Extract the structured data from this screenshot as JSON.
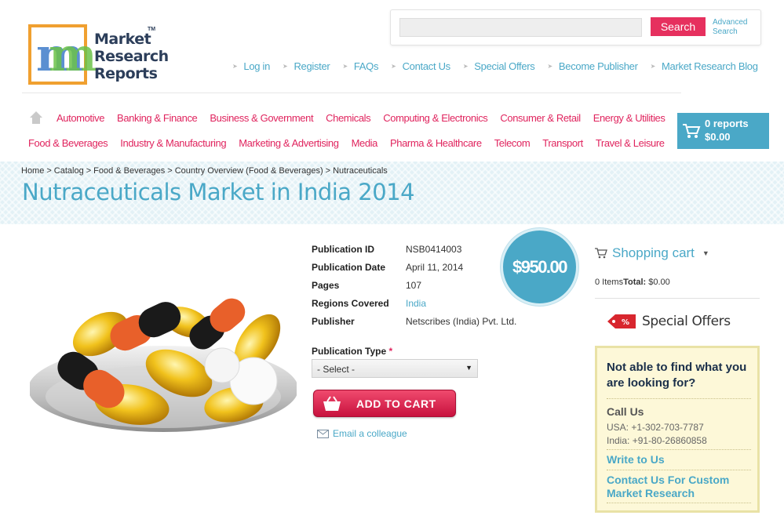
{
  "logo": {
    "line1": "Market",
    "line2": "Research",
    "line3": "Reports",
    "tm": "TM"
  },
  "search": {
    "placeholder": "",
    "button_label": "Search",
    "advanced_line1": "Advanced",
    "advanced_line2": "Search"
  },
  "top_nav": [
    "Log in",
    "Register",
    "FAQs",
    "Contact Us",
    "Special Offers",
    "Become Publisher",
    "Market Research Blog"
  ],
  "categories_row1": [
    "Automotive",
    "Banking & Finance",
    "Business & Government",
    "Chemicals",
    "Computing & Electronics",
    "Consumer & Retail",
    "Energy & Utilities"
  ],
  "categories_row2": [
    "Food & Beverages",
    "Industry & Manufacturing",
    "Marketing & Advertising",
    "Media",
    "Pharma & Healthcare",
    "Telecom",
    "Transport",
    "Travel & Leisure"
  ],
  "cart_button": {
    "reports": "0 reports",
    "total": "$0.00"
  },
  "breadcrumb": [
    "Home",
    "Catalog",
    "Food & Beverages",
    "Country Overview (Food & Beverages)",
    "Nutraceuticals"
  ],
  "page_title": "Nutraceuticals Market in India 2014",
  "details": {
    "publication_id_label": "Publication ID",
    "publication_id": "NSB0414003",
    "publication_date_label": "Publication Date",
    "publication_date": "April 11, 2014",
    "pages_label": "Pages",
    "pages": "107",
    "regions_label": "Regions Covered",
    "regions": "India",
    "publisher_label": "Publisher",
    "publisher": "Netscribes (India) Pvt. Ltd."
  },
  "price": "$950.00",
  "publication_type": {
    "label": "Publication Type",
    "required_mark": "*",
    "selected": "- Select -"
  },
  "add_to_cart_label": "ADD TO CART",
  "email_colleague_label": "Email a colleague",
  "shopping_cart": {
    "title": "Shopping cart",
    "items": "0 Items",
    "total_label": "Total:",
    "total_value": "$0.00"
  },
  "special_offers_label": "Special Offers",
  "help_box": {
    "question": "Not able to find what you are looking for?",
    "call_us": "Call Us",
    "usa_phone": "USA: +1-302-703-7787",
    "india_phone": "India: +91-80-26860858",
    "write_to_us": "Write to Us",
    "custom_research": "Contact Us For Custom Market Research"
  },
  "colors": {
    "accent_blue": "#4aa8c7",
    "accent_pink": "#e0245e",
    "search_button": "#e6305e"
  }
}
